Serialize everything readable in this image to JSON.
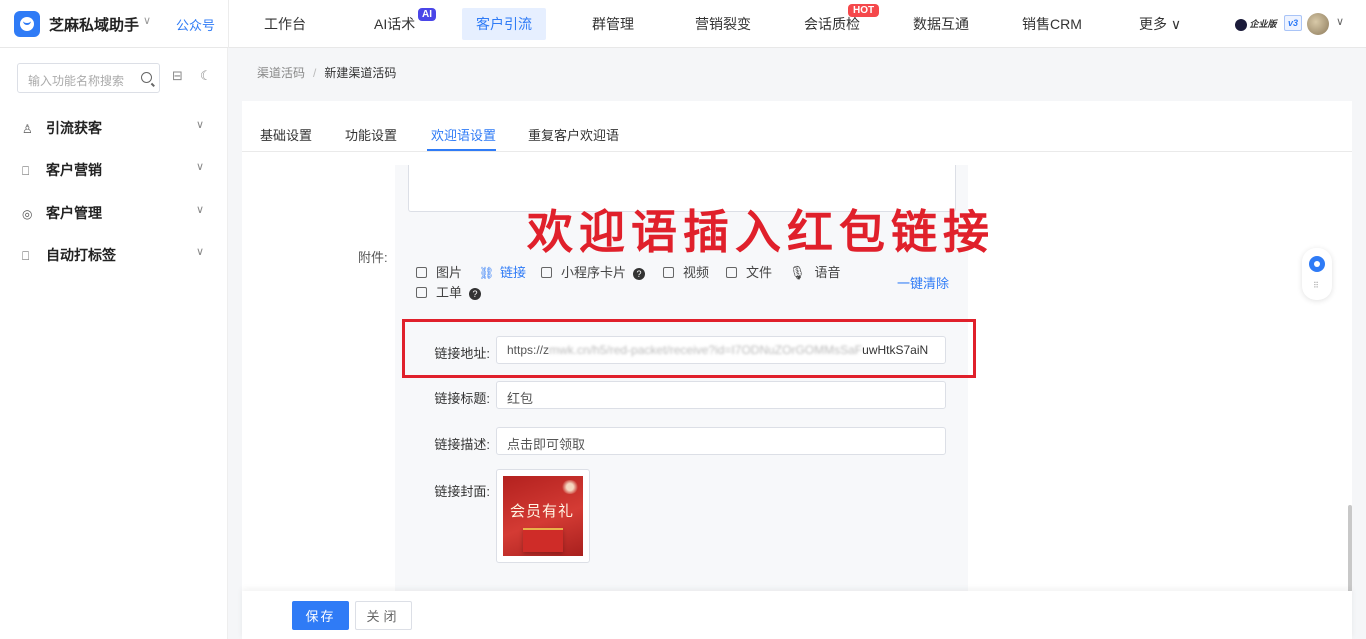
{
  "topbar": {
    "brand": "芝麻私域助手",
    "gzh": "公众号",
    "nav": [
      "工作台",
      "AI话术",
      "客户引流",
      "群管理",
      "营销裂变",
      "会话质检",
      "数据互通",
      "销售CRM",
      "更多 ∨"
    ],
    "tag_ai": "AI",
    "tag_hot": "HOT",
    "enterprise": "企业版",
    "version": "v3",
    "colors": {
      "accent": "#2f7bf6",
      "hot": "#f5484b",
      "ai": "#4a46e8"
    }
  },
  "sidebar": {
    "search_placeholder": "输入功能名称搜索",
    "items": [
      {
        "label": "引流获客",
        "icon": "user-plus-icon"
      },
      {
        "label": "客户营销",
        "icon": "bookmark-icon"
      },
      {
        "label": "客户管理",
        "icon": "customer-icon"
      },
      {
        "label": "自动打标签",
        "icon": "tag-icon"
      }
    ]
  },
  "breadcrumb": {
    "parent": "渠道活码",
    "sep": "/",
    "current": "新建渠道活码"
  },
  "tabs": [
    "基础设置",
    "功能设置",
    "欢迎语设置",
    "重复客户欢迎语"
  ],
  "active_tab": "欢迎语设置",
  "overlay_title": "欢迎语插入红包链接",
  "attachment": {
    "label": "附件:",
    "types": [
      "图片",
      "链接",
      "小程序卡片",
      "视频",
      "文件",
      "语音",
      "工单"
    ],
    "clear_all": "一键清除"
  },
  "link_form": {
    "url_label": "链接地址:",
    "url_prefix": "https://z",
    "url_blurred": "mwk.cn/h5/red-packet/receive?id=I7ODNuZOrGOMMsSaF",
    "url_tail": "uwHtkS7aiN",
    "title_label": "链接标题:",
    "title_value": "红包",
    "desc_label": "链接描述:",
    "desc_value": "点击即可领取",
    "cover_label": "链接封面:",
    "cover_text": "会员有礼"
  },
  "footer": {
    "save": "保存",
    "close": "关闭"
  }
}
